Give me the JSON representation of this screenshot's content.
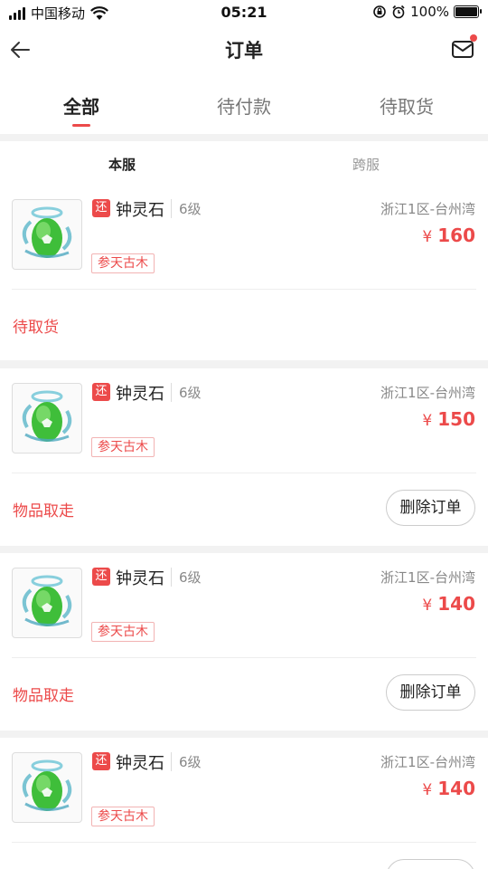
{
  "status_bar": {
    "carrier": "中国移动",
    "time": "05:21",
    "battery_percent": "100%",
    "battery_level": 1.0
  },
  "header": {
    "title": "订单"
  },
  "tabs": [
    {
      "label": "全部",
      "active": true
    },
    {
      "label": "待付款",
      "active": false
    },
    {
      "label": "待取货",
      "active": false
    }
  ],
  "subtabs": [
    {
      "label": "本服",
      "active": true
    },
    {
      "label": "跨服",
      "active": false
    }
  ],
  "orders": [
    {
      "badge": "还",
      "name": "钟灵石",
      "level": "6级",
      "server": "浙江1区-台州湾",
      "currency": "¥",
      "price": "160",
      "tag": "参天古木",
      "status": "待取货",
      "action": ""
    },
    {
      "badge": "还",
      "name": "钟灵石",
      "level": "6级",
      "server": "浙江1区-台州湾",
      "currency": "¥",
      "price": "150",
      "tag": "参天古木",
      "status": "物品取走",
      "action": "删除订单"
    },
    {
      "badge": "还",
      "name": "钟灵石",
      "level": "6级",
      "server": "浙江1区-台州湾",
      "currency": "¥",
      "price": "140",
      "tag": "参天古木",
      "status": "物品取走",
      "action": "删除订单"
    },
    {
      "badge": "还",
      "name": "钟灵石",
      "level": "6级",
      "server": "浙江1区-台州湾",
      "currency": "¥",
      "price": "140",
      "tag": "参天古木",
      "status": "",
      "action": ""
    }
  ],
  "colors": {
    "accent": "#ec4a4a",
    "background": "#f2f2f2"
  }
}
